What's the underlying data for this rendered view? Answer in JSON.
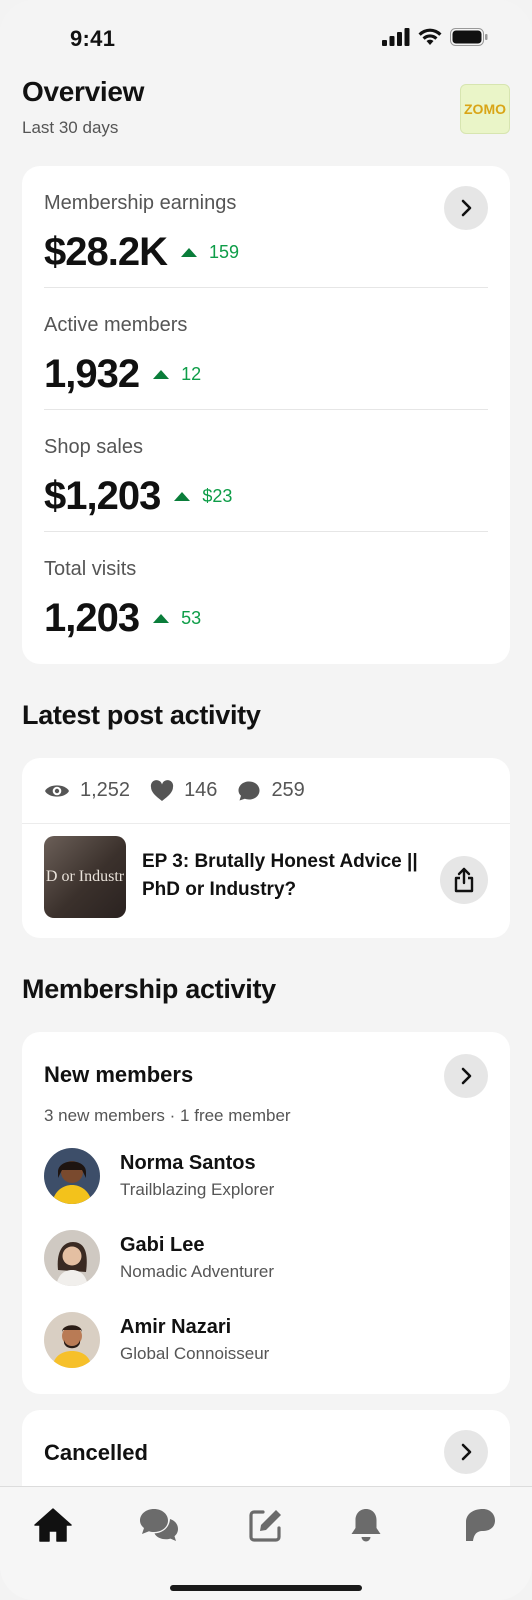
{
  "status_bar": {
    "time": "9:41"
  },
  "header": {
    "title": "Overview",
    "subtitle": "Last 30 days",
    "logo_text": "ZOMO"
  },
  "stats": [
    {
      "label": "Membership earnings",
      "value": "$28.2K",
      "delta": "159"
    },
    {
      "label": "Active members",
      "value": "1,932",
      "delta": "12"
    },
    {
      "label": "Shop sales",
      "value": "$1,203",
      "delta": "$23"
    },
    {
      "label": "Total visits",
      "value": "1,203",
      "delta": "53"
    }
  ],
  "post_activity": {
    "section_title": "Latest post activity",
    "views": "1,252",
    "likes": "146",
    "comments": "259",
    "thumbnail_text": "D or Industr",
    "post_title": "EP 3: Brutally Honest Advice || PhD or Industry?"
  },
  "membership": {
    "section_title": "Membership activity",
    "new_members": {
      "heading": "New members",
      "summary": "3 new members · 1 free member",
      "members": [
        {
          "name": "Norma Santos",
          "tier": "Trailblazing Explorer"
        },
        {
          "name": "Gabi Lee",
          "tier": "Nomadic Adventurer"
        },
        {
          "name": "Amir Nazari",
          "tier": "Global Connoisseur"
        }
      ]
    },
    "cancelled": {
      "heading": "Cancelled"
    }
  },
  "tabbar": {
    "items": [
      {
        "icon": "home-icon",
        "active": true
      },
      {
        "icon": "chat-icon",
        "active": false
      },
      {
        "icon": "edit-icon",
        "active": false
      },
      {
        "icon": "bell-icon",
        "active": false
      },
      {
        "icon": "patreon-icon",
        "active": false
      }
    ]
  },
  "colors": {
    "accent_positive": "#0e9d48",
    "background": "#f4f4f4",
    "card": "#ffffff"
  }
}
